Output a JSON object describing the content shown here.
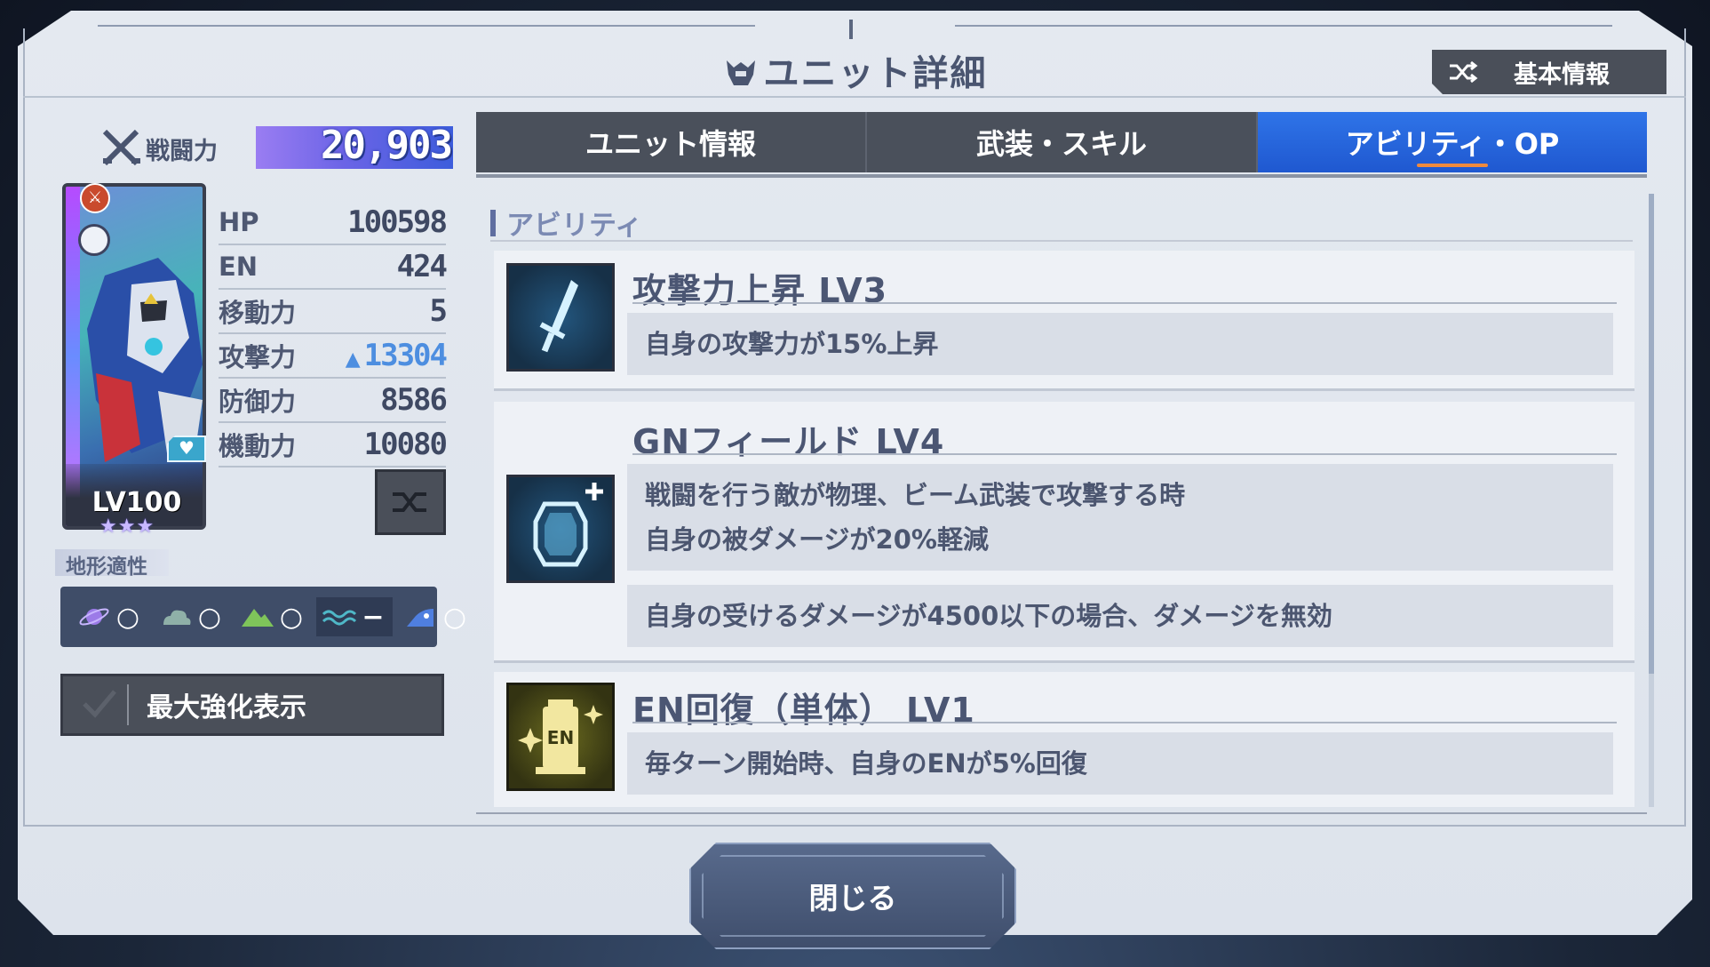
{
  "header": {
    "title": "ユニット詳細",
    "basic_info_label": "基本情報"
  },
  "power": {
    "label": "戦闘力",
    "value": "20,903"
  },
  "unit": {
    "level": "LV100",
    "stars": "★★★",
    "stats": [
      {
        "label": "HP",
        "value": "100598",
        "boosted": false
      },
      {
        "label": "EN",
        "value": "424",
        "boosted": false
      },
      {
        "label": "移動力",
        "value": "5",
        "boosted": false
      },
      {
        "label": "攻撃力",
        "value": "13304",
        "boosted": true
      },
      {
        "label": "防御力",
        "value": "8586",
        "boosted": false
      },
      {
        "label": "機動力",
        "value": "10080",
        "boosted": false
      }
    ]
  },
  "terrain": {
    "label": "地形適性",
    "items": [
      {
        "icon": "space-planet-icon",
        "grade": "○"
      },
      {
        "icon": "air-cloud-icon",
        "grade": "○"
      },
      {
        "icon": "ground-mountain-icon",
        "grade": "○"
      },
      {
        "icon": "water-wave-icon",
        "grade": "−"
      },
      {
        "icon": "underwater-icon",
        "grade": "○"
      }
    ]
  },
  "max_enhance_label": "最大強化表示",
  "tabs": [
    {
      "label": "ユニット情報",
      "active": false
    },
    {
      "label": "武装・スキル",
      "active": false
    },
    {
      "label": "アビリティ・OP",
      "active": true
    }
  ],
  "section_title": "アビリティ",
  "abilities": [
    {
      "icon": "sword-icon",
      "name": "攻撃力上昇 LV3",
      "desc": [
        "自身の攻撃力が15%上昇"
      ]
    },
    {
      "icon": "shield-plus-icon",
      "name": "GNフィールド LV4",
      "desc": [
        "戦闘を行う敵が物理、ビーム武装で攻撃する時",
        "自身の被ダメージが20%軽減"
      ],
      "desc2": "自身の受けるダメージが4500以下の場合、ダメージを無効"
    },
    {
      "icon": "en-tank-icon",
      "name": "EN回復（単体） LV1",
      "desc": [
        "毎ターン開始時、自身のENが5%回復"
      ]
    }
  ],
  "close_label": "閉じる"
}
